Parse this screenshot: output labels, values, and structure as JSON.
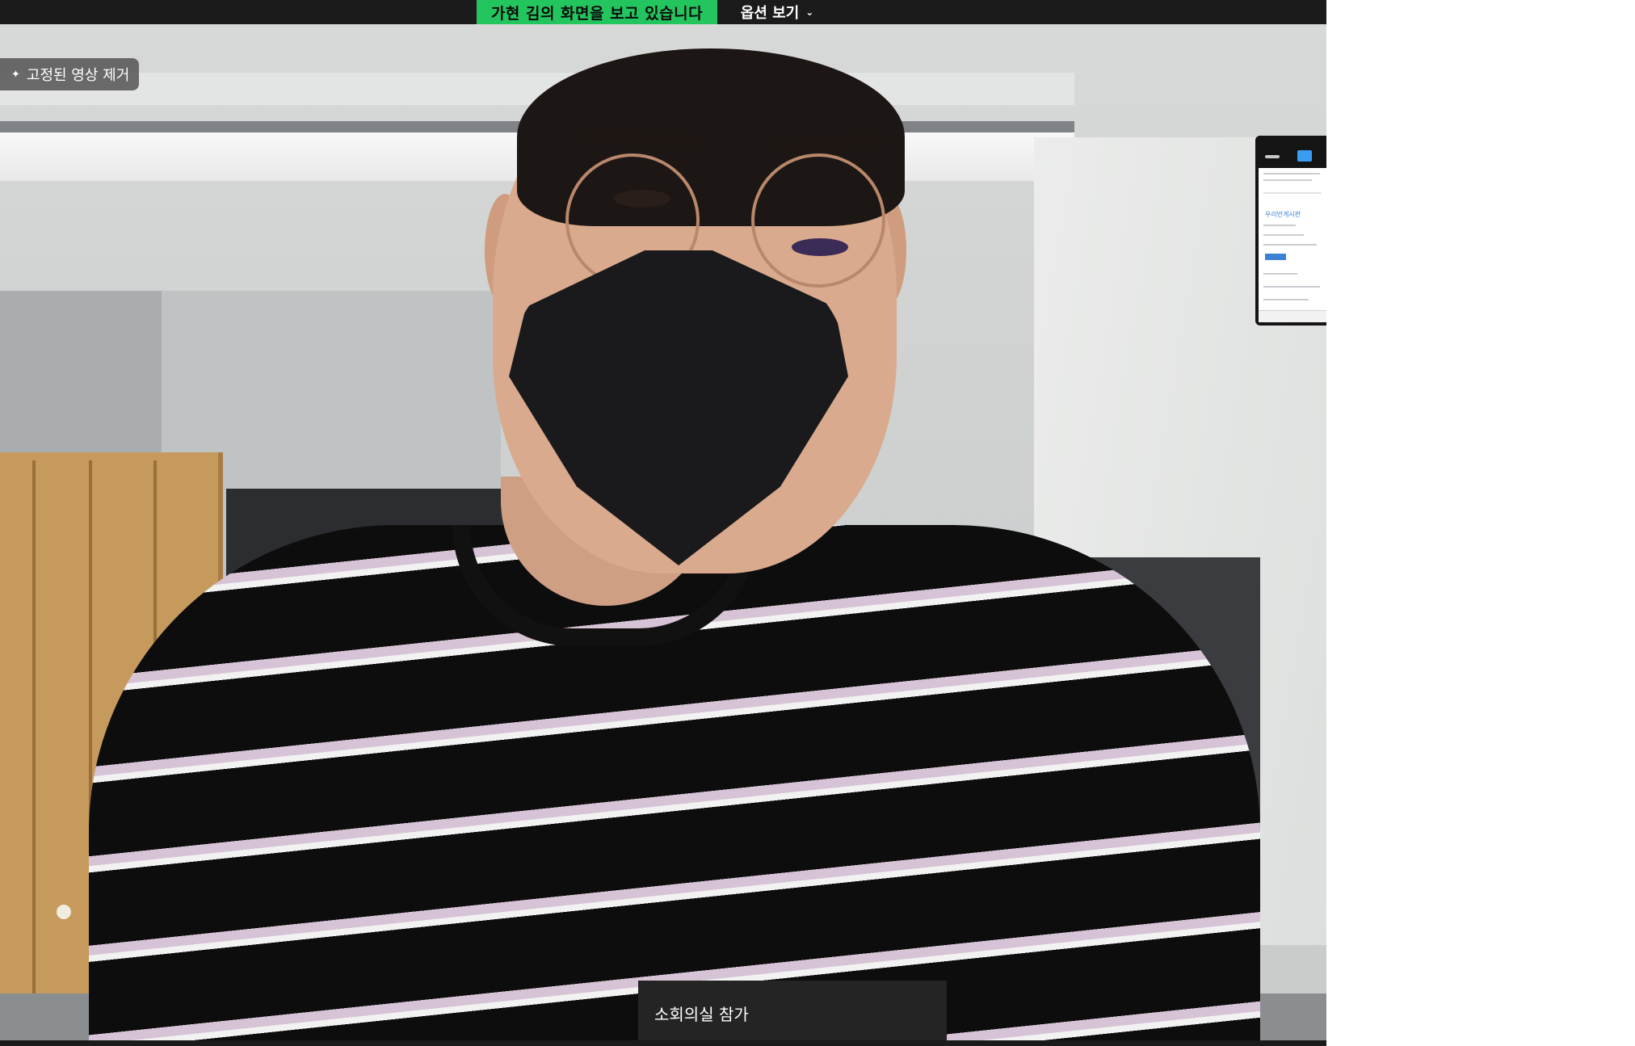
{
  "share_banner": {
    "text": "가현 김의 화면을 보고 있습니다"
  },
  "view_options": {
    "label": "옵션 보기"
  },
  "pinned_video": {
    "unpin_label": "고정된 영상 제거"
  },
  "thumbnail": {
    "title": "우리반게시판"
  },
  "breakout": {
    "join_label": "소회의실 참가"
  },
  "colors": {
    "share_banner_bg": "#22c55e",
    "toolbar_bg": "#1b1b1b",
    "thumb_accent": "#3b9cf3"
  },
  "icons": {
    "pin": "pin-icon",
    "chevron": "chevron-down-icon",
    "minimize": "minimize-icon",
    "view": "view-mode-icon"
  }
}
